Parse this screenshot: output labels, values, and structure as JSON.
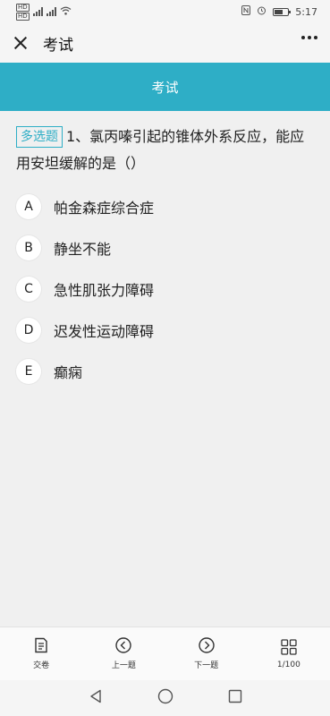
{
  "status_bar": {
    "time": "5:17",
    "icons": [
      "hd-icon",
      "signal-icon",
      "signal-icon",
      "wifi-icon",
      "nfc-icon",
      "alarm-icon",
      "battery-icon"
    ]
  },
  "header": {
    "title": "考试",
    "close_icon": "close-icon",
    "more_icon": "more-icon"
  },
  "banner": {
    "title": "考试"
  },
  "question": {
    "type_label": "多选题",
    "text": "1、氯丙嗪引起的锥体外系反应，能应用安坦缓解的是（）"
  },
  "options": [
    {
      "letter": "A",
      "text": "帕金森症综合症"
    },
    {
      "letter": "B",
      "text": "静坐不能"
    },
    {
      "letter": "C",
      "text": "急性肌张力障碍"
    },
    {
      "letter": "D",
      "text": "迟发性运动障碍"
    },
    {
      "letter": "E",
      "text": "癫痫"
    }
  ],
  "toolbar": {
    "submit_label": "交卷",
    "prev_label": "上一题",
    "next_label": "下一题",
    "progress_label": "1/100"
  },
  "colors": {
    "accent": "#2eaec6",
    "background": "#f0f0f0"
  }
}
